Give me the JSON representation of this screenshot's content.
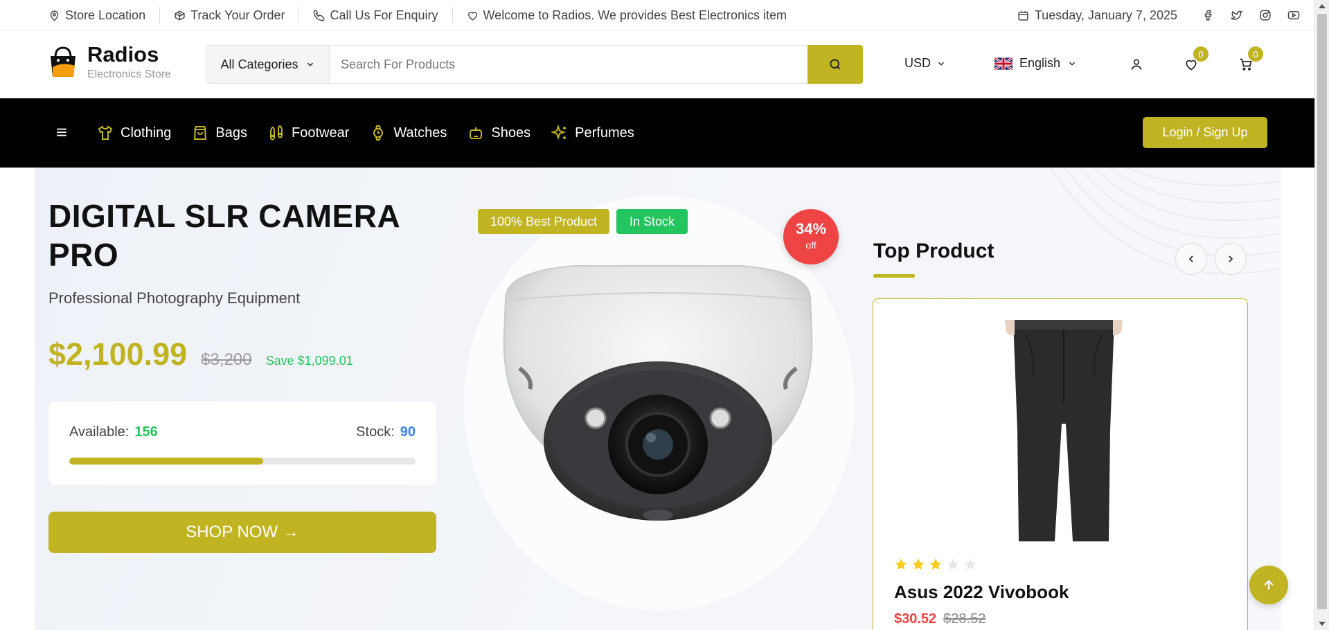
{
  "topbar": {
    "store_location": "Store Location",
    "track_order": "Track Your Order",
    "call_us": "Call Us For Enquiry",
    "welcome": "Welcome to Radios. We provides Best Electronics item",
    "date": "Tuesday, January 7, 2025",
    "social_icons": [
      "facebook-icon",
      "twitter-icon",
      "instagram-icon",
      "youtube-icon"
    ]
  },
  "header": {
    "logo_name": "Radios",
    "logo_sub": "Electronics Store",
    "category_select": "All Categories",
    "search_placeholder": "Search For Products",
    "currency": "USD",
    "language": "English",
    "wishlist_count": "0",
    "cart_count": "0"
  },
  "nav": {
    "items": [
      {
        "label": "Clothing",
        "icon": "shirt-icon"
      },
      {
        "label": "Bags",
        "icon": "bag-icon"
      },
      {
        "label": "Footwear",
        "icon": "footprints-icon"
      },
      {
        "label": "Watches",
        "icon": "watch-icon"
      },
      {
        "label": "Shoes",
        "icon": "shoe-icon"
      },
      {
        "label": "Perfumes",
        "icon": "sparkles-icon"
      }
    ],
    "login": "Login / Sign Up"
  },
  "hero": {
    "title": "DIGITAL SLR CAMERA PRO",
    "subtitle": "Professional Photography Equipment",
    "price": "$2,100.99",
    "old_price": "$3,200",
    "save": "Save $1,099.01",
    "available_label": "Available:",
    "available_value": "156",
    "stock_label": "Stock:",
    "stock_value": "90",
    "progress_fraction": 0.56,
    "shop_now": "SHOP NOW →",
    "tag_best": "100% Best Product",
    "tag_stock": "In Stock",
    "discount_pct": "34%",
    "discount_off": "off"
  },
  "top_product": {
    "title": "Top Product",
    "product_name": "Asus 2022 Vivobook",
    "price": "$30.52",
    "old_price": "$28.52",
    "rating": 3,
    "rating_max": 5
  },
  "colors": {
    "accent": "#c1b422",
    "success": "#22c55e",
    "danger": "#ef4444",
    "info": "#3b82f6",
    "navbar": "#000000"
  }
}
